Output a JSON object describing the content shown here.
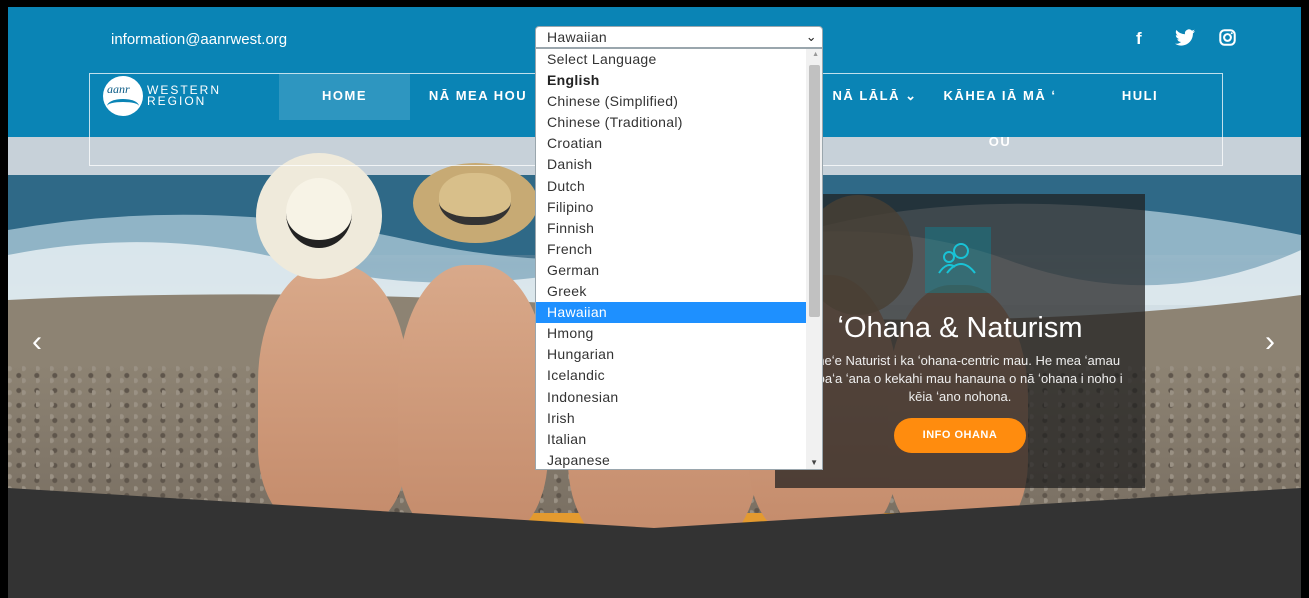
{
  "header": {
    "email": "information@aanrwest.org",
    "social": [
      {
        "name": "facebook-icon",
        "glyph": "f"
      },
      {
        "name": "twitter-icon",
        "glyph": "🐦"
      },
      {
        "name": "instagram-icon",
        "glyph": "◎"
      }
    ]
  },
  "logo": {
    "mark": "aanr",
    "line1": "WESTERN",
    "line2": "REGION"
  },
  "nav": {
    "items": [
      {
        "label": "HOME",
        "active": true
      },
      {
        "label": "NĀ MEA HOU"
      },
      {
        "label": "NĀ LĀLĀ ⌄"
      },
      {
        "label": "KĀHEA IĀ MĀ ʻ"
      },
      {
        "label": "OU"
      },
      {
        "label": "HULI"
      }
    ]
  },
  "language_select": {
    "selected": "Hawaiian",
    "options": [
      "Select Language",
      "English",
      "Chinese (Simplified)",
      "Chinese (Traditional)",
      "Croatian",
      "Danish",
      "Dutch",
      "Filipino",
      "Finnish",
      "French",
      "German",
      "Greek",
      "Hawaiian",
      "Hmong",
      "Hungarian",
      "Icelandic",
      "Indonesian",
      "Irish",
      "Italian",
      "Japanese"
    ],
    "highlighted_index": 12,
    "bold_index": 1
  },
  "slider": {
    "prev": "‹",
    "next": "›"
  },
  "card": {
    "title": "ʻOhana & Naturism",
    "text": "ka neʻe Naturist i ka ʻohana-centric mau. He mea ʻamau ka loaʻa ʻana o kekahi mau hanauna o nā ʻohana i noho i kēia ʻano nohona.",
    "button": "INFO OHANA"
  },
  "colors": {
    "brand": "#0a84b5",
    "accent": "#ff8c0e",
    "highlight": "#1e90ff"
  }
}
